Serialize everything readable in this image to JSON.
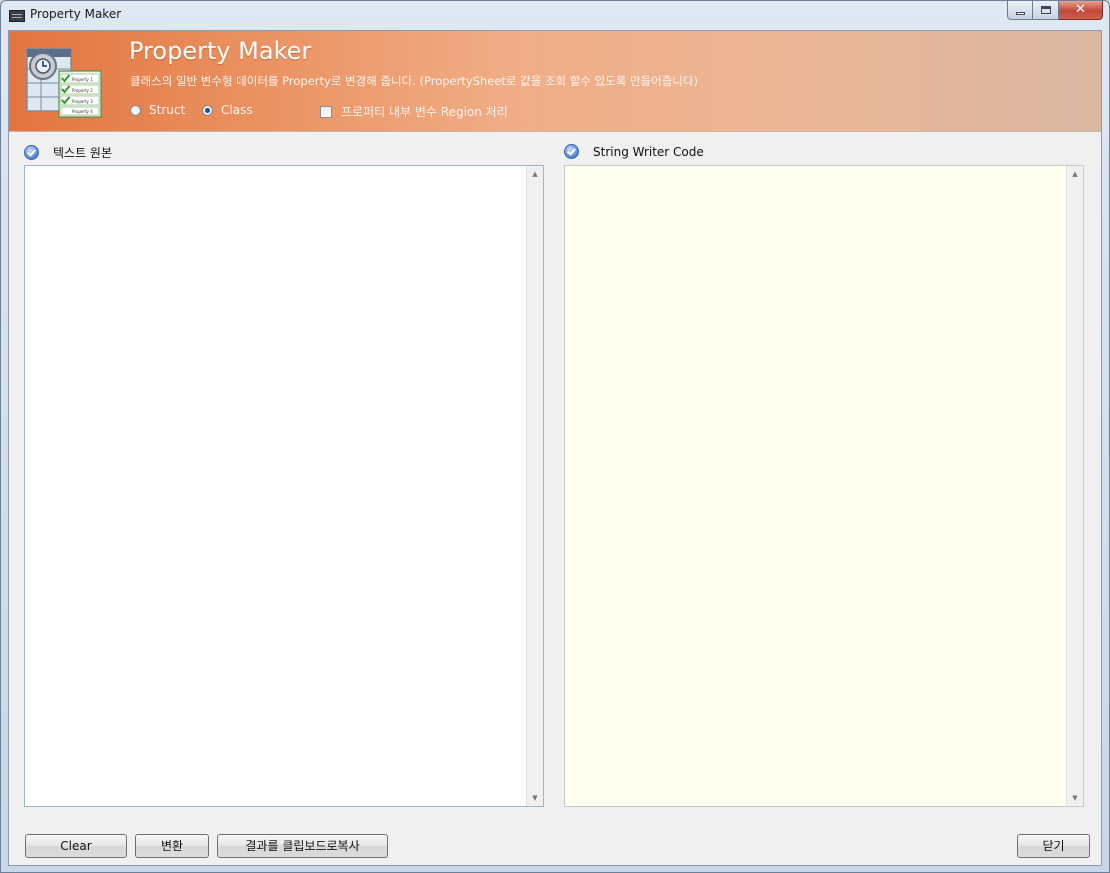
{
  "window": {
    "title": "Property Maker"
  },
  "header": {
    "title": "Property Maker",
    "subtitle": "클래스의 일반 변수형 데이터를 Property로 변경해 줍니다. (PropertySheet로 값을 조회 할수 있도록 만들어줍니다)",
    "logo_labels": [
      "Property 1",
      "Property 2",
      "Property 3",
      "Property 4"
    ],
    "options": {
      "struct_label": "Struct",
      "class_label": "Class",
      "selected": "Class",
      "region_label": "프로퍼티 내부 변수 Region 처리",
      "region_checked": false
    }
  },
  "left_panel": {
    "label": "텍스트 원본",
    "value": ""
  },
  "right_panel": {
    "label": "String Writer Code",
    "value": "",
    "background": "#fffff0"
  },
  "buttons": {
    "clear": "Clear",
    "convert": "변환",
    "copy": "결과를 클립보드로복사",
    "close": "닫기"
  },
  "icons": [
    "app-icon",
    "minimize-icon",
    "maximize-icon",
    "close-icon",
    "check-circle-icon",
    "scroll-up-icon",
    "scroll-down-icon"
  ]
}
